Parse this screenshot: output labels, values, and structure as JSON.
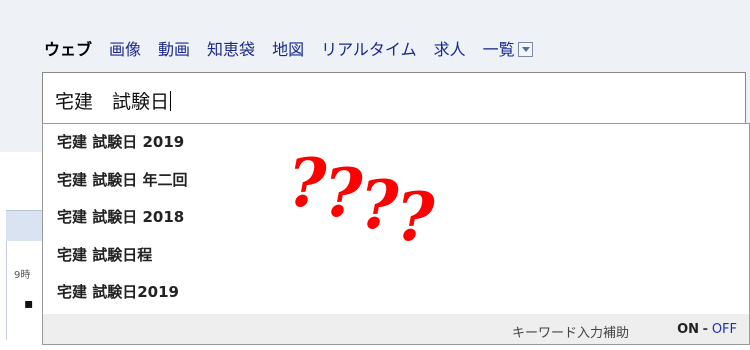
{
  "tabs": {
    "web": "ウェブ",
    "images": "画像",
    "video": "動画",
    "chiebukuro": "知恵袋",
    "map": "地図",
    "realtime": "リアルタイム",
    "jobs": "求人",
    "more": "一覧"
  },
  "search": {
    "query": "宅建　試験日"
  },
  "suggestions": [
    "宅建 試験日 2019",
    "宅建 試験日 年二回",
    "宅建 試験日 2018",
    "宅建 試験日程",
    "宅建 試験日2019"
  ],
  "footer": {
    "assist_label": "キーワード入力補助",
    "on": "ON",
    "separator": "-",
    "off": "OFF"
  },
  "annotation": {
    "marks": [
      "?",
      "?",
      "?",
      "?"
    ]
  },
  "background_page": {
    "snippet_text": "9時",
    "bullet": "▪"
  }
}
